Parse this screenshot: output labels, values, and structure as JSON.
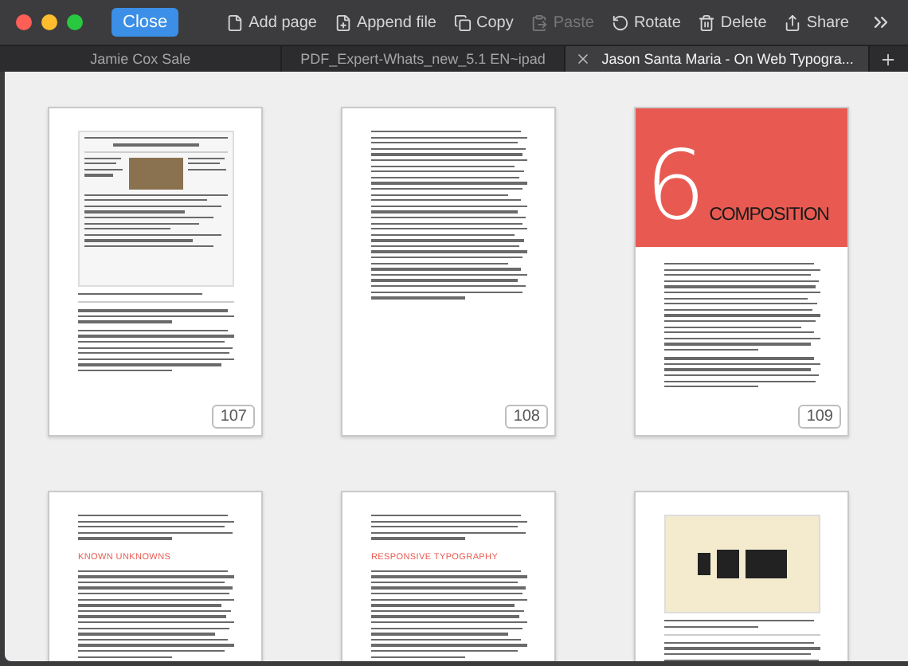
{
  "toolbar": {
    "close_button": "Close",
    "actions": [
      {
        "kind": "add_page",
        "label": "Add page",
        "disabled": false
      },
      {
        "kind": "append_file",
        "label": "Append file",
        "disabled": false
      },
      {
        "kind": "copy",
        "label": "Copy",
        "disabled": false
      },
      {
        "kind": "paste",
        "label": "Paste",
        "disabled": true
      },
      {
        "kind": "rotate",
        "label": "Rotate",
        "disabled": false
      },
      {
        "kind": "delete",
        "label": "Delete",
        "disabled": false
      },
      {
        "kind": "share",
        "label": "Share",
        "disabled": false
      }
    ]
  },
  "tabs": [
    {
      "label": "Jamie Cox Sale",
      "selected": false
    },
    {
      "label": "PDF_Expert-Whats_new_5.1 EN~ipad",
      "selected": false
    },
    {
      "label": "Jason Santa Maria - On Web Typogra...",
      "selected": true
    }
  ],
  "pages": [
    {
      "kind": "screenshot_figure",
      "number": "107"
    },
    {
      "kind": "text",
      "number": "108"
    },
    {
      "kind": "chapter_opener",
      "chapter": "6",
      "title": "COMPOSITION",
      "number": "109"
    },
    {
      "kind": "section",
      "heading": "KNOWN UNKNOWNS"
    },
    {
      "kind": "section",
      "heading": "RESPONSIVE TYPOGRAPHY"
    },
    {
      "kind": "illustration"
    }
  ]
}
